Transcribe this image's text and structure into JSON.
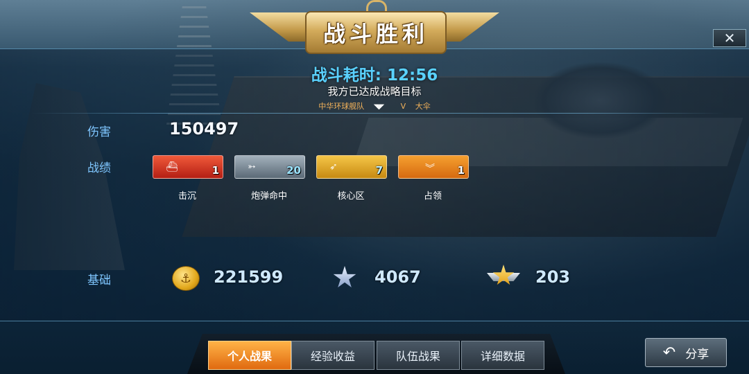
{
  "banner": {
    "title": "战斗胜利"
  },
  "header": {
    "battle_time_label": "战斗耗时:",
    "battle_time": "12:56",
    "objective": "我方已达成战略目标",
    "fleet_name": "中华环球舰队",
    "rank": "V",
    "player": "大伞"
  },
  "stats": {
    "damage_label": "伤害",
    "damage_value": "150497",
    "record_label": "战绩",
    "badges": [
      {
        "caption": "击沉",
        "count": "1",
        "icon": "ship-sink-icon",
        "color": "#d8341f"
      },
      {
        "caption": "炮弹命中",
        "count": "20",
        "icon": "shell-hit-icon",
        "color": "#7f8d99"
      },
      {
        "caption": "核心区",
        "count": "7",
        "icon": "core-zone-icon",
        "color": "#e2a52a"
      },
      {
        "caption": "占领",
        "count": "1",
        "icon": "capture-chevron-icon",
        "color": "#ef8a20"
      }
    ]
  },
  "base": {
    "label": "基础",
    "gold": "221599",
    "silver_star": "4067",
    "gold_star": "203"
  },
  "tabs": {
    "personal": "个人战果",
    "experience": "经验收益",
    "team": "队伍战果",
    "details": "详细数据"
  },
  "share": {
    "label": "分享"
  },
  "close": {
    "label": "✕"
  },
  "colors": {
    "accent_blue": "#5ad2ff",
    "active_tab": "#f08a20",
    "gold": "#d3ab5b"
  }
}
